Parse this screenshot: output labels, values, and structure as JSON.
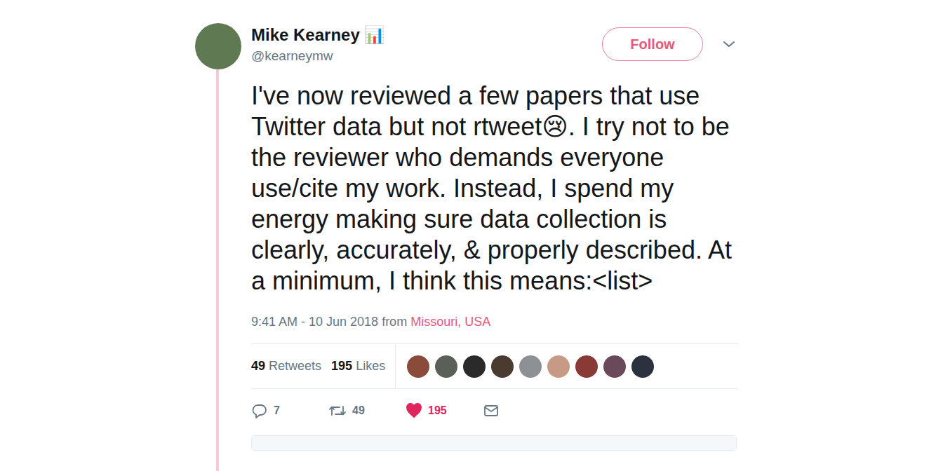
{
  "author": {
    "name": "Mike Kearney 📊",
    "handle": "@kearneymw"
  },
  "follow_button": "Follow",
  "tweet_text": "I've now reviewed a few papers that use Twitter data but not rtweet😢. I try not to be the reviewer who demands everyone use/cite my work. Instead, I spend my energy making sure data collection is clearly, accurately, & properly described. At a minimum, I think this means:<list>",
  "timestamp": "9:41 AM - 10 Jun 2018 from ",
  "location": "Missouri, USA",
  "stats": [
    {
      "count": "49",
      "label": "Retweets"
    },
    {
      "count": "195",
      "label": "Likes"
    }
  ],
  "likers": [
    {
      "color": "#8a4b3a"
    },
    {
      "color": "#5a5f58"
    },
    {
      "color": "#2a2a2a"
    },
    {
      "color": "#4a3a30"
    },
    {
      "color": "#8d9094"
    },
    {
      "color": "#c79a86"
    },
    {
      "color": "#8a3a34"
    },
    {
      "color": "#6a4a5a"
    },
    {
      "color": "#2c3140"
    }
  ],
  "actions": [
    {
      "kind": "reply",
      "count": "7",
      "selected": false
    },
    {
      "kind": "retweet",
      "count": "49",
      "selected": false
    },
    {
      "kind": "like",
      "count": "195",
      "selected": true
    },
    {
      "kind": "message",
      "count": "",
      "selected": false
    }
  ]
}
